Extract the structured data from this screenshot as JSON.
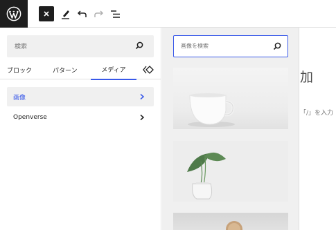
{
  "toolbar": {
    "logo_icon": "wordpress-logo",
    "close_icon": "close-icon",
    "edit_icon": "pencil-icon",
    "undo_icon": "undo-icon",
    "redo_icon": "redo-icon",
    "outline_icon": "list-view-icon"
  },
  "inserter": {
    "search": {
      "placeholder": "検索"
    },
    "tabs": [
      {
        "label": "ブロック"
      },
      {
        "label": "パターン"
      },
      {
        "label": "メディア",
        "active": true
      }
    ],
    "categories": [
      {
        "label": "画像",
        "selected": true
      },
      {
        "label": "Openverse"
      }
    ]
  },
  "media_preview": {
    "search": {
      "placeholder": "画像を検索"
    }
  },
  "editor": {
    "title_fragment": "加",
    "hint_fragment": "「/」を入力"
  },
  "colors": {
    "accent": "#3858e9",
    "dark": "#1e1e1e",
    "panel_bg": "#f0f0f0"
  }
}
